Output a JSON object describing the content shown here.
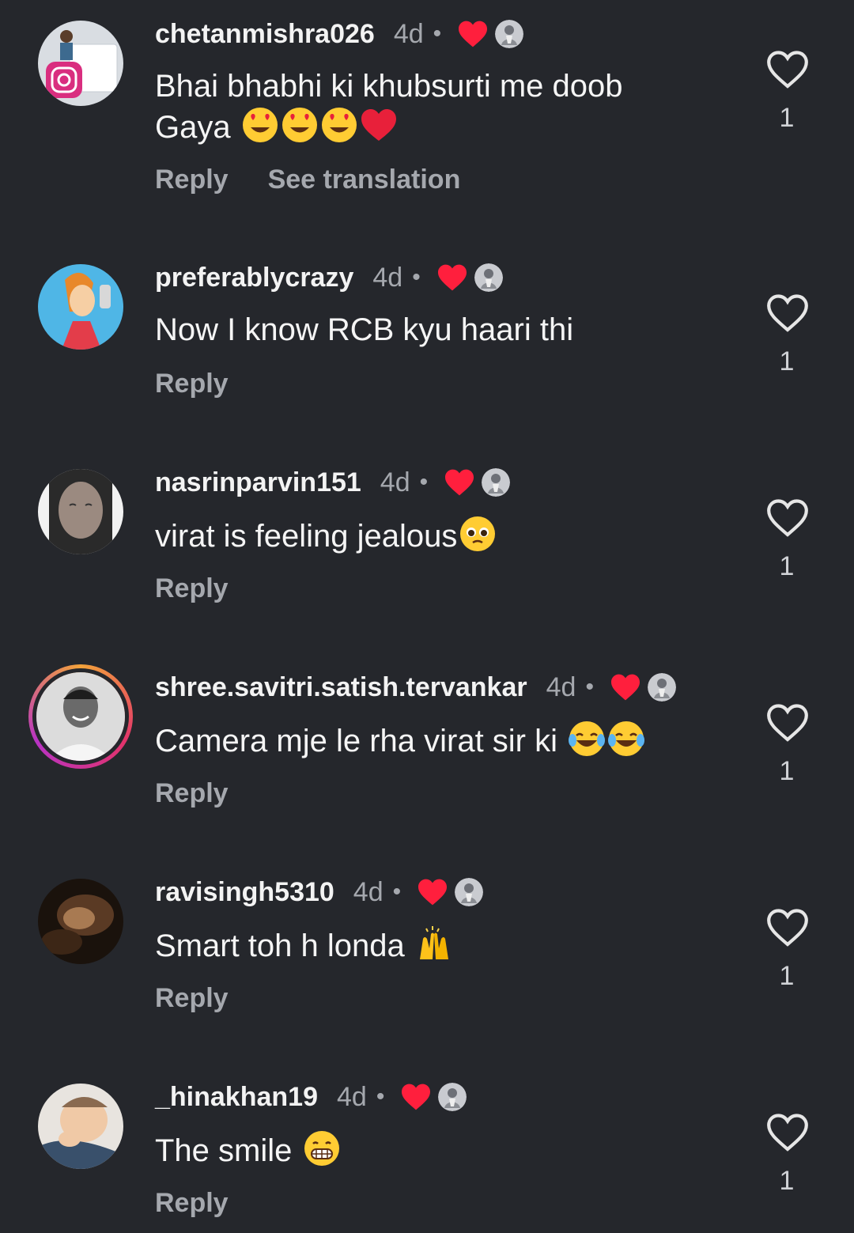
{
  "comments": [
    {
      "username": "chetanmishra026",
      "time": "4d",
      "text": "Bhai bhabhi ki khubsurti me doob Gaya",
      "text_emojis": [
        "heart-eyes",
        "heart-eyes",
        "heart-eyes",
        "red-heart"
      ],
      "actions": [
        "Reply",
        "See translation"
      ],
      "likes": "1",
      "author_liked": true
    },
    {
      "username": "preferablycrazy",
      "time": "4d",
      "text": "Now I know RCB kyu haari thi",
      "text_emojis": [],
      "actions": [
        "Reply"
      ],
      "likes": "1",
      "author_liked": true
    },
    {
      "username": "nasrinparvin151",
      "time": "4d",
      "text": "virat is feeling jealous",
      "text_emojis": [
        "pleading-face"
      ],
      "actions": [
        "Reply"
      ],
      "likes": "1",
      "author_liked": true
    },
    {
      "username": "shree.savitri.satish.tervankar",
      "time": "4d",
      "text": "Camera mje le rha virat sir ki",
      "text_emojis": [
        "tears-of-joy",
        "tears-of-joy"
      ],
      "actions": [
        "Reply"
      ],
      "likes": "1",
      "author_liked": true,
      "has_story_ring": true
    },
    {
      "username": "ravisingh5310",
      "time": "4d",
      "text": "Smart toh h londa",
      "text_emojis": [
        "raising-hands"
      ],
      "actions": [
        "Reply"
      ],
      "likes": "1",
      "author_liked": true
    },
    {
      "username": "_hinakhan19",
      "time": "4d",
      "text": "The smile",
      "text_emojis": [
        "grinning-face"
      ],
      "actions": [
        "Reply"
      ],
      "likes": "1",
      "author_liked": true
    }
  ],
  "colors": {
    "background": "#25272c",
    "text": "#f3f3f3",
    "muted": "#a5a8ae",
    "heart_red": "#ff1f3d"
  }
}
